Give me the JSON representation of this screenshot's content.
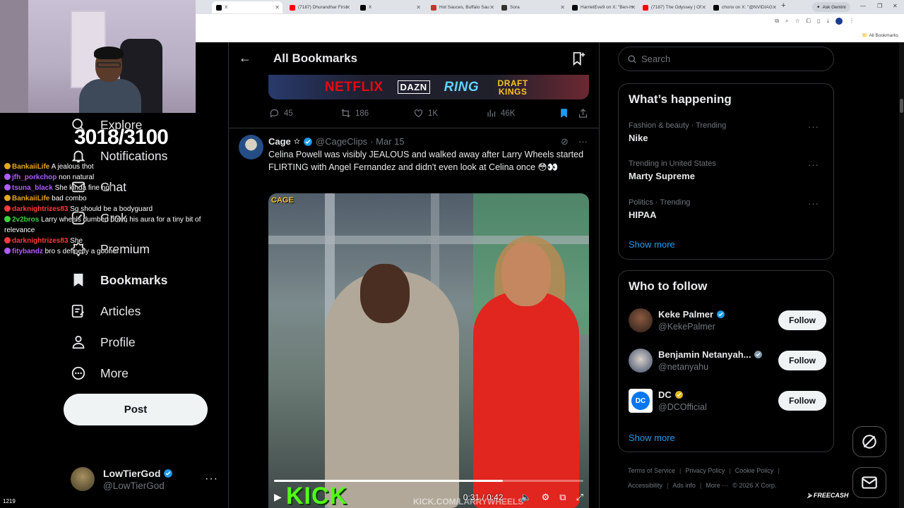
{
  "browser": {
    "tabs": [
      {
        "label": "X",
        "active": true,
        "color": "#000000"
      },
      {
        "label": "(7187) Dhurandhar First",
        "active": false,
        "color": "#ff0000"
      },
      {
        "label": "X",
        "active": false,
        "color": "#000000"
      },
      {
        "label": "Hot Sauces, Buffalo Sau",
        "active": false,
        "color": "#c0392b"
      },
      {
        "label": "Sora",
        "active": false,
        "color": "#333333"
      },
      {
        "label": "HarrietEve9 on X: \"Ben-H",
        "active": false,
        "color": "#000000"
      },
      {
        "label": "(7187) The Odyssey | Of",
        "active": false,
        "color": "#ff0000"
      },
      {
        "label": "chonx on X: \"@NVIDIAG",
        "active": false,
        "color": "#000000"
      }
    ],
    "ask_gemini": "Ask Gemini",
    "all_bookmarks": "All Bookmarks"
  },
  "stream": {
    "counter": "3018/3100",
    "viewers": "1219",
    "chat": [
      {
        "user": "BankaiiLife",
        "color": "#e5a624",
        "msg": "A jealous thot"
      },
      {
        "user": "jfh_porkchop",
        "color": "#b05cff",
        "msg": "non natural"
      },
      {
        "user": "tsuna_black",
        "color": "#b05cff",
        "msg": "She kinda fine ngl"
      },
      {
        "user": "BankaiiLife",
        "color": "#e5a624",
        "msg": "bad combo"
      },
      {
        "user": "darknightrizes83",
        "color": "#ff3b3b",
        "msg": "Sg should be a bodyguard"
      },
      {
        "user": "2v2bros",
        "color": "#3fd13f",
        "msg": "Larry wheels dumbed down his aura for a tiny bit of relevance"
      },
      {
        "user": "darknightrizes83",
        "color": "#ff3b3b",
        "msg": "She"
      },
      {
        "user": "fitybandz",
        "color": "#b05cff",
        "msg": "bro s definetly a gooner"
      }
    ]
  },
  "nav": {
    "items": [
      {
        "label": "Explore",
        "icon": "search-icon"
      },
      {
        "label": "Notifications",
        "icon": "bell-icon"
      },
      {
        "label": "Chat",
        "icon": "mail-icon"
      },
      {
        "label": "Grok",
        "icon": "grok-icon"
      },
      {
        "label": "Premium",
        "icon": "premium-icon"
      },
      {
        "label": "Bookmarks",
        "icon": "bookmark-icon"
      },
      {
        "label": "Articles",
        "icon": "articles-icon"
      },
      {
        "label": "Profile",
        "icon": "person-icon"
      },
      {
        "label": "More",
        "icon": "more-circle-icon"
      }
    ],
    "post_label": "Post",
    "user": {
      "name": "LowTierGod",
      "handle": "@LowTierGod"
    }
  },
  "main": {
    "title": "All Bookmarks",
    "sponsors": [
      "NETFLIX",
      "DAZN",
      "RING",
      "DRAFT KINGS"
    ],
    "prev_tweet": {
      "replies": "45",
      "reposts": "186",
      "likes": "1K",
      "views": "46K"
    },
    "tweet": {
      "name": "Cage",
      "handle": "@CageClips",
      "date": "· Mar 15",
      "text": "Celina Powell was visibly JEALOUS and walked away after Larry Wheels started FLIRTING with Angel Fernandez and didn't even look at Celina once 😳👀",
      "video": {
        "logo": "CAGE",
        "watermark_brand": "KICK",
        "watermark_url": "KICK.COM/LARRYWHEELS",
        "time": "0:31 / 0:42",
        "progress": 0.74
      }
    }
  },
  "right": {
    "search_placeholder": "Search",
    "happening_title": "What’s happening",
    "trends": [
      {
        "category": "Fashion & beauty · Trending",
        "name": "Nike"
      },
      {
        "category": "Trending in United States",
        "name": "Marty Supreme"
      },
      {
        "category": "Politics · Trending",
        "name": "HIPAA"
      }
    ],
    "show_more": "Show more",
    "wtf_title": "Who to follow",
    "follow": [
      {
        "name": "Keke Palmer",
        "handle": "@KekePalmer",
        "badge": "#1d9bf0"
      },
      {
        "name": "Benjamin Netanyah...",
        "handle": "@netanyahu",
        "badge": "#829aab"
      },
      {
        "name": "DC",
        "handle": "@DCOfficial",
        "badge": "#e2b719"
      }
    ],
    "follow_label": "Follow",
    "footer": {
      "terms": "Terms of Service",
      "privacy": "Privacy Policy",
      "cookie": "Cookie Policy",
      "accessibility": "Accessibility",
      "ads": "Ads info",
      "more": "More ···",
      "copyright": "© 2026 X Corp."
    },
    "freecash": "FREECASH"
  }
}
